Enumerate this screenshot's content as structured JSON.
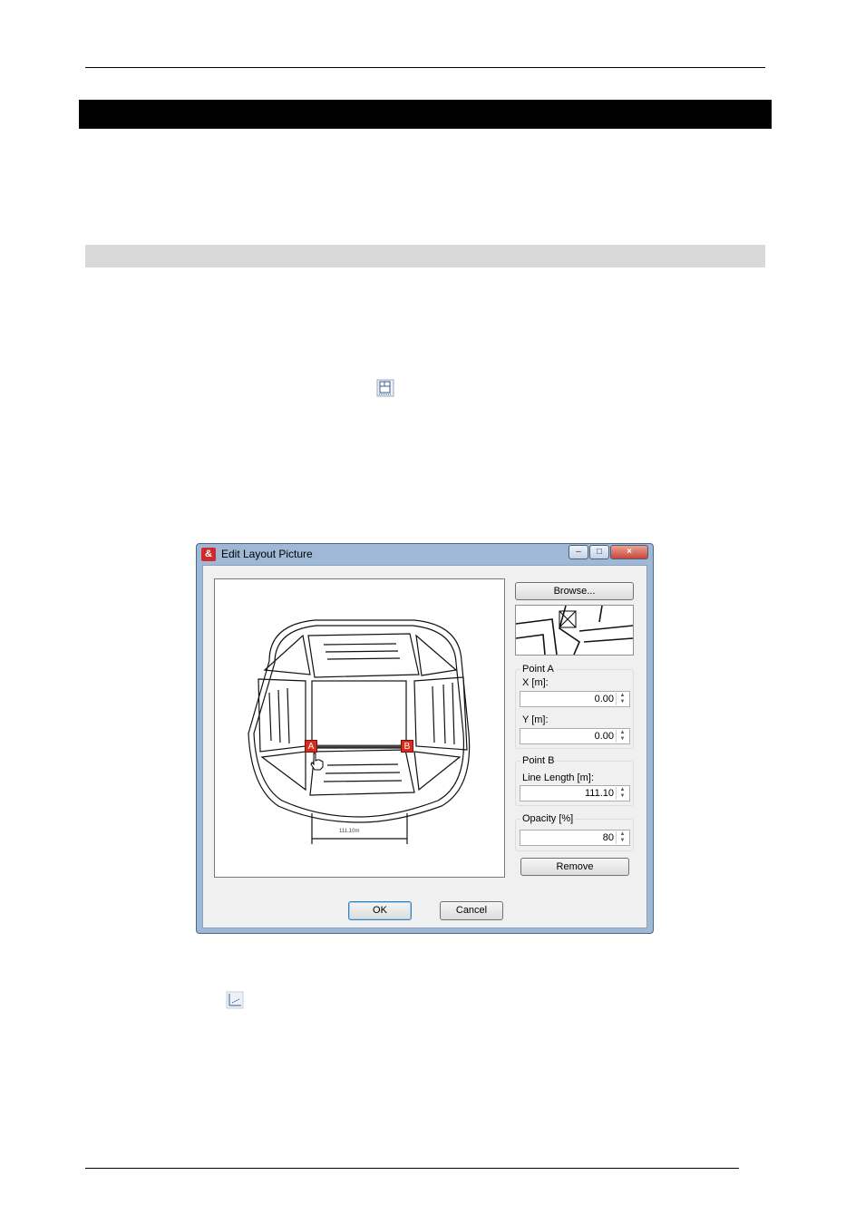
{
  "document": {
    "toolbar_icon_layout": "layout-picture-icon",
    "toolbar_icon_measure": "measure-icon"
  },
  "dialog": {
    "title": "Edit Layout Picture",
    "app_icon_text": "&",
    "browse_label": "Browse...",
    "canvas": {
      "marker_a": "A",
      "marker_b": "B",
      "dimension_label": "111,10m"
    },
    "point_a": {
      "group_label": "Point A",
      "x_label": "X [m]:",
      "x_value": "0.00",
      "y_label": "Y [m]:",
      "y_value": "0.00"
    },
    "point_b": {
      "group_label": "Point B",
      "length_label": "Line Length [m]:",
      "length_value": "111.10"
    },
    "opacity": {
      "group_label": "Opacity [%]",
      "value": "80"
    },
    "remove_label": "Remove",
    "ok_label": "OK",
    "cancel_label": "Cancel"
  }
}
